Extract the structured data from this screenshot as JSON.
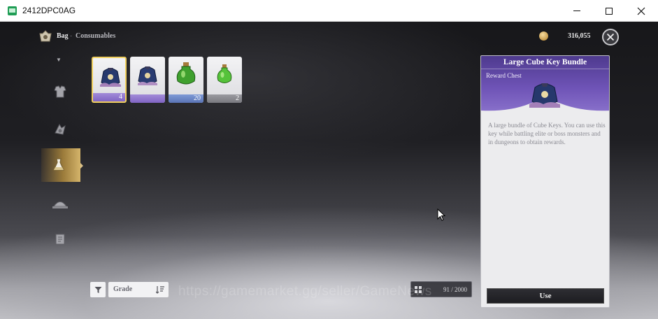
{
  "window": {
    "title": "2412DPC0AG"
  },
  "header": {
    "section": "Bag",
    "separator": "·",
    "category": "Consumables",
    "currency_value": "316,055"
  },
  "items": [
    {
      "name": "Large Cube Key Bundle",
      "count": "4",
      "grade_color": "purple",
      "selected": true
    },
    {
      "name": "Cube Key Bundle",
      "count": "",
      "grade_color": "purple",
      "selected": false
    },
    {
      "name": "Green Potion",
      "count": "20",
      "grade_color": "blue",
      "selected": false
    },
    {
      "name": "Small Green Potion",
      "count": "2",
      "grade_color": "grey",
      "selected": false
    }
  ],
  "detail": {
    "title": "Large Cube Key Bundle",
    "type": "Reward Chest",
    "description": "A large bundle of Cube Keys. You can use this key while battling elite or boss monsters and in dungeons to obtain rewards.",
    "use_label": "Use"
  },
  "filters": {
    "sort_label": "Grade"
  },
  "capacity": {
    "value": "91 / 2000"
  },
  "watermark": "https://gamemarket.gg/seller/GameNews",
  "colors": {
    "accent_gold": "#f0cf5c",
    "grade_purple": "#8064c4",
    "grade_blue": "#5a74b6",
    "panel_header": "#6e53b6"
  }
}
